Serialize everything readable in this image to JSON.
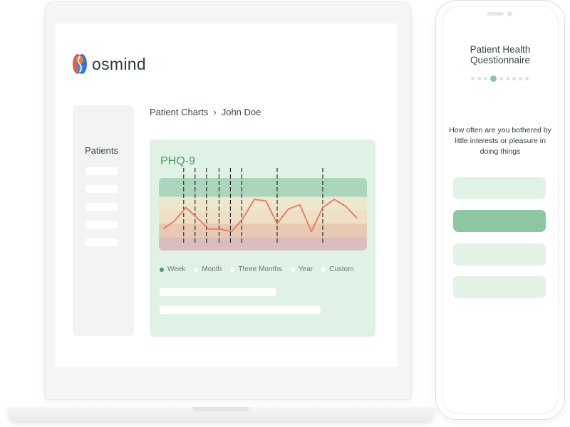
{
  "brand": {
    "name": "osmind"
  },
  "sidebar": {
    "heading": "Patients",
    "items": 5
  },
  "breadcrumb": {
    "parent": "Patient Charts",
    "separator": "›",
    "current": "John Doe"
  },
  "chart": {
    "title": "PHQ-9",
    "filters": [
      {
        "label": "Week",
        "active": true
      },
      {
        "label": "Month",
        "active": false
      },
      {
        "label": "Three Months",
        "active": false
      },
      {
        "label": "Year",
        "active": false
      },
      {
        "label": "Custom",
        "active": false
      }
    ]
  },
  "chart_data": {
    "type": "line",
    "title": "PHQ-9",
    "xlabel": "",
    "ylabel": "",
    "ylim": [
      0,
      27
    ],
    "bands": [
      {
        "from": 0,
        "to": 5,
        "color": "#dcbdbd"
      },
      {
        "from": 5,
        "to": 10,
        "color": "#e8c9b4"
      },
      {
        "from": 10,
        "to": 15,
        "color": "#efdfc6"
      },
      {
        "from": 15,
        "to": 20,
        "color": "#eee7cd"
      },
      {
        "from": 20,
        "to": 27,
        "color": "#acd6bb"
      }
    ],
    "series": [
      {
        "values": [
          8,
          11,
          16,
          12,
          8,
          8,
          7,
          12,
          19,
          18.5,
          10,
          15.5,
          17,
          7,
          16,
          19,
          16.5,
          12
        ],
        "color": "#e07a62"
      }
    ],
    "markers": [
      1.8,
      2.8,
      3.8,
      4.9,
      5.9,
      6.9,
      10.0,
      14.0
    ],
    "grid": false
  },
  "questionnaire": {
    "title": "Patient Health Questionnaire",
    "question": "How often are you bothered by little interests or pleasure in doing things",
    "steps": 9,
    "active_step": 3,
    "answers": [
      {
        "selected": false
      },
      {
        "selected": true
      },
      {
        "selected": false
      },
      {
        "selected": false
      }
    ]
  },
  "colors": {
    "accent": "#4f9a6d",
    "card": "#e0f1e5",
    "selected_answer": "#8ec6a3",
    "answer": "#e2f2e7",
    "line": "#e07a62"
  }
}
